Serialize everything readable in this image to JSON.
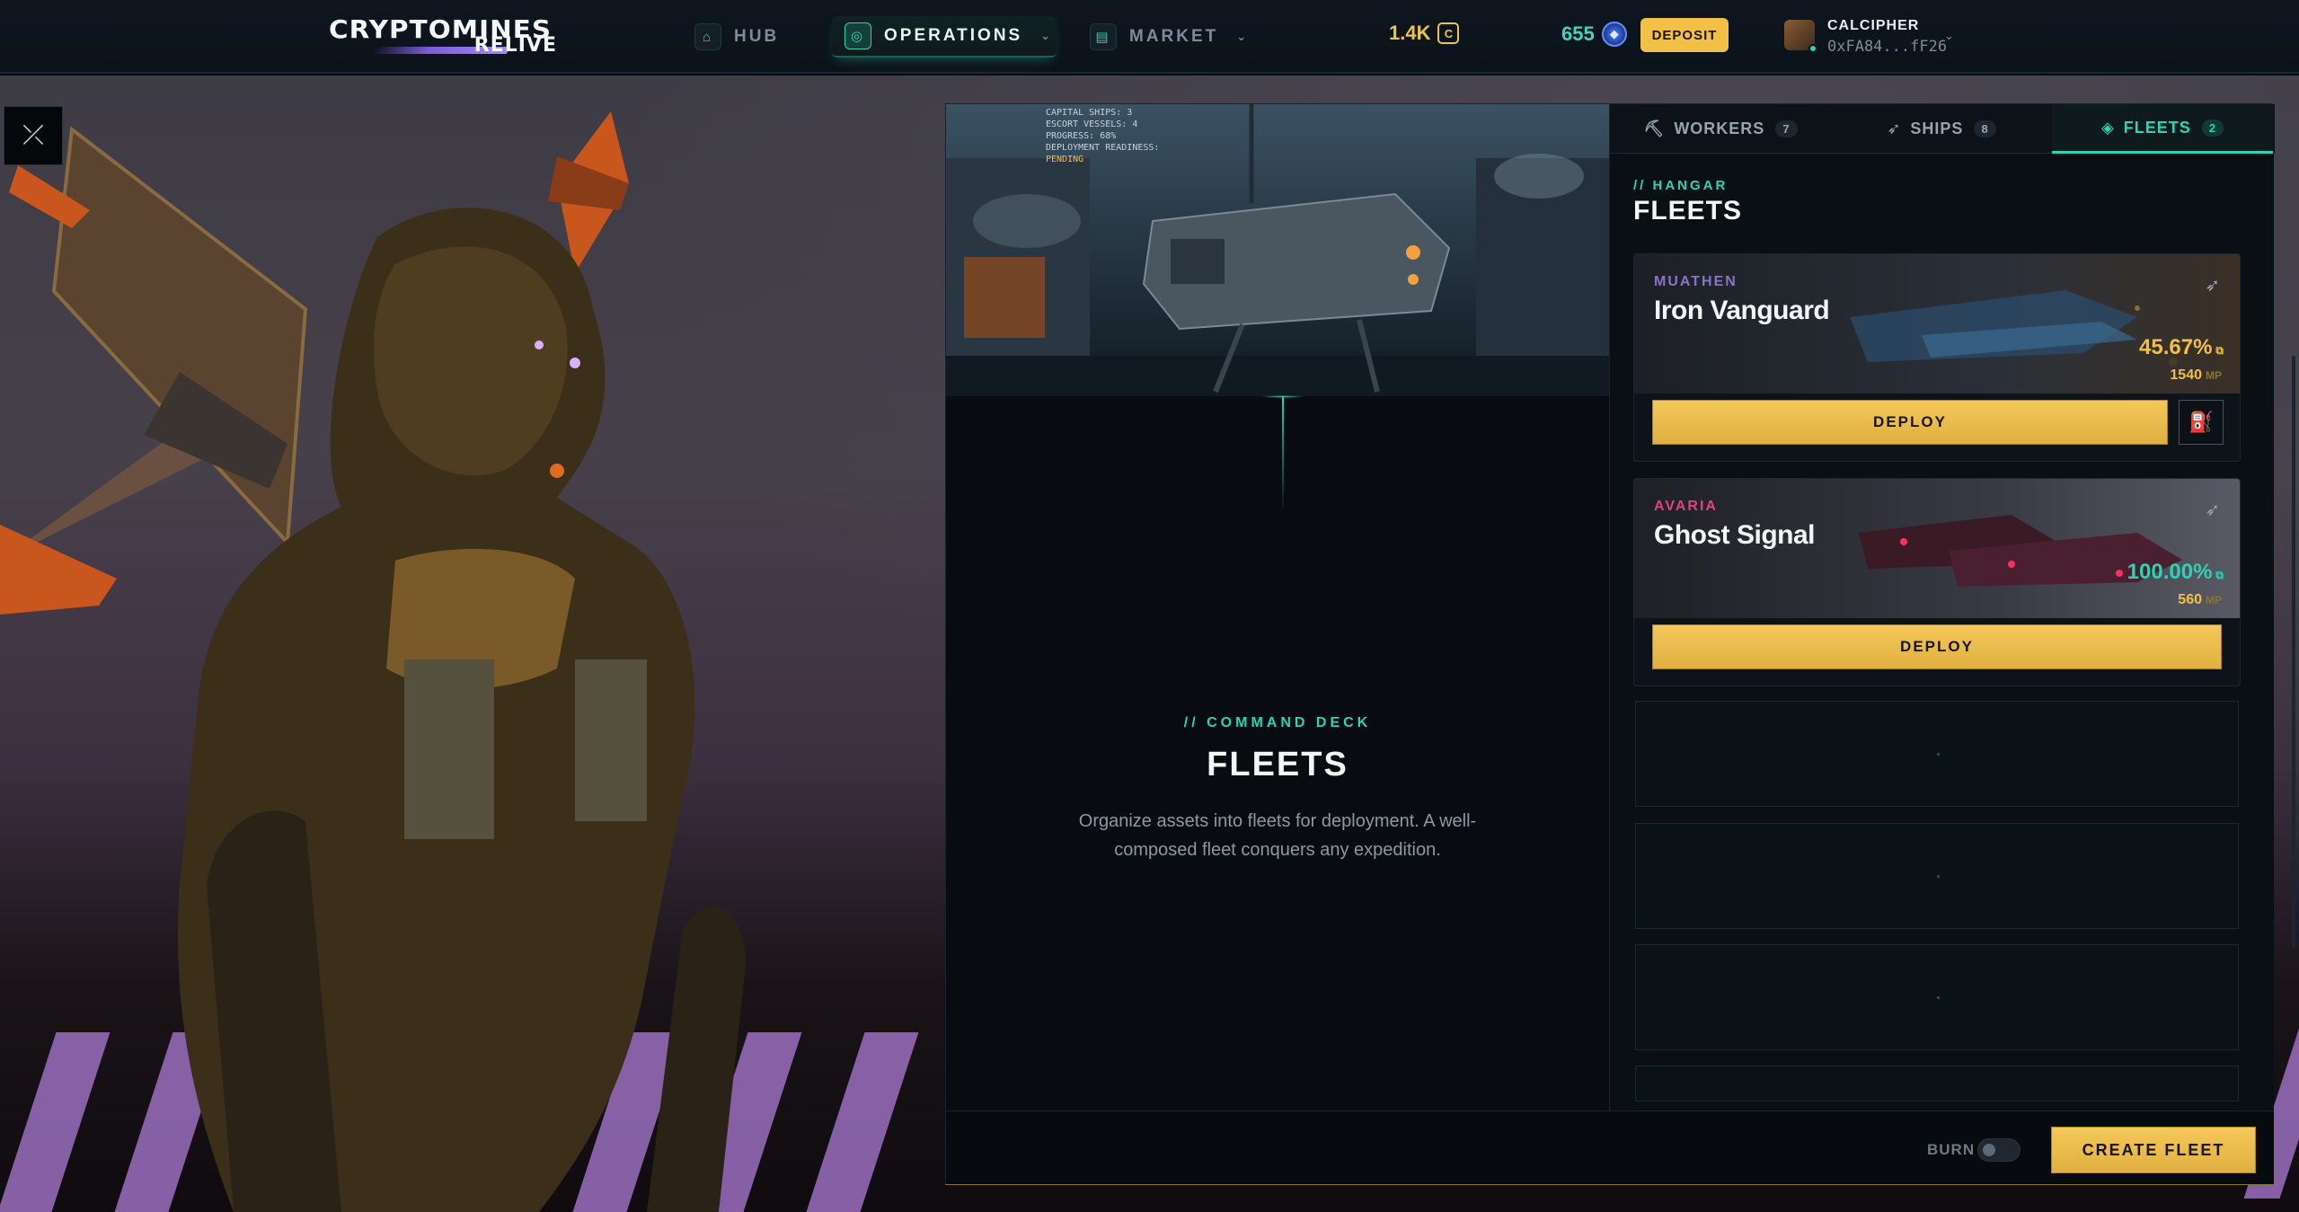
{
  "nav": {
    "logo_top": "CRYPTOMINES",
    "logo_bottom": "RELIVE",
    "items": [
      {
        "label": "HUB",
        "icon": "home-icon"
      },
      {
        "label": "OPERATIONS",
        "icon": "compass-icon",
        "active": true
      },
      {
        "label": "MARKET",
        "icon": "store-icon"
      }
    ],
    "coin_balance": "1.4K",
    "coin_symbol": "C",
    "gem_balance": "655",
    "deposit_label": "DEPOSIT",
    "user": {
      "name": "CALCIPHER",
      "address": "0xFA84...fF26"
    }
  },
  "hero_hud": {
    "lines": [
      "CAPITAL SHIPS: 3",
      "ESCORT VESSELS: 4",
      "PROGRESS: 68%",
      "DEPLOYMENT READINESS:",
      "PENDING"
    ]
  },
  "command": {
    "overline": "// COMMAND DECK",
    "title": "FLEETS",
    "description": "Organize assets into fleets for deployment. A well-composed fleet conquers any expedition."
  },
  "tabs": [
    {
      "label": "WORKERS",
      "count": "7"
    },
    {
      "label": "SHIPS",
      "count": "8"
    },
    {
      "label": "FLEETS",
      "count": "2",
      "active": true
    }
  ],
  "hangar": {
    "overline": "// HANGAR",
    "title": "FLEETS"
  },
  "fleets": [
    {
      "faction": "MUATHEN",
      "name": "Iron Vanguard",
      "efficiency": "45.67%",
      "mp": "1540",
      "mp_unit": "MP",
      "deploy_label": "DEPLOY",
      "faction_color": "#8a74c8",
      "pct_color": "#f2c046"
    },
    {
      "faction": "AVARIA",
      "name": "Ghost Signal",
      "efficiency": "100.00%",
      "mp": "560",
      "mp_unit": "MP",
      "deploy_label": "DEPLOY",
      "faction_color": "#e0457a",
      "pct_color": "#2bd4b2"
    }
  ],
  "bottom": {
    "burn_label": "BURN",
    "burn_enabled": false,
    "create_label": "CREATE FLEET"
  },
  "colors": {
    "accent": "#2bd4b2",
    "gold": "#f2c046",
    "panel": "#080c11"
  }
}
